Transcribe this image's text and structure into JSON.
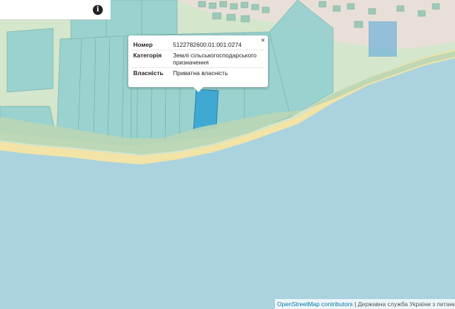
{
  "popup": {
    "close_label": "×",
    "rows": [
      {
        "key": "Номер",
        "value": "5122782600:01:001:0274"
      },
      {
        "key": "Категорія",
        "value": "Землі сільськогосподарського призначення"
      },
      {
        "key": "Власність",
        "value": "Приватна власність"
      }
    ]
  },
  "info_icon": "i",
  "attribution": {
    "osm": "OpenStreetMap contributors",
    "separator": " | ",
    "gov": "Державна служба України з питань геодезії, картографії та кадастру"
  },
  "colors": {
    "sea": "#aad3df",
    "parcel": "#8fcfcf",
    "selected_parcel": "#3fa9d4",
    "beach": "#f5e6a8",
    "land": "#cfe3c8"
  },
  "icons": [
    "info-icon",
    "close-icon"
  ]
}
